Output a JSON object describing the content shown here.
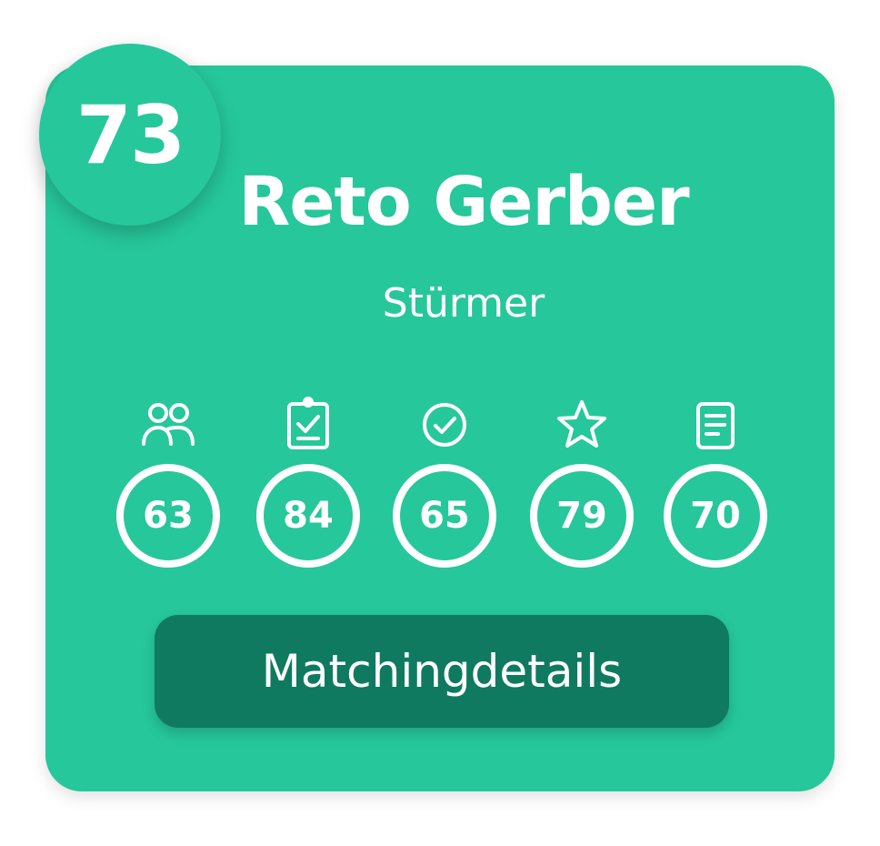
{
  "profile": {
    "overall_score": "73",
    "name": "Reto Gerber",
    "position": "Stürmer"
  },
  "metrics": [
    {
      "icon": "users-icon",
      "value": "63"
    },
    {
      "icon": "clipboard-check-icon",
      "value": "84"
    },
    {
      "icon": "check-circle-icon",
      "value": "65"
    },
    {
      "icon": "star-icon",
      "value": "79"
    },
    {
      "icon": "document-icon",
      "value": "70"
    }
  ],
  "button": {
    "label": "Matchingdetails"
  },
  "colors": {
    "card": "#26c79b",
    "button": "#0f7a5f",
    "text": "#ffffff"
  }
}
